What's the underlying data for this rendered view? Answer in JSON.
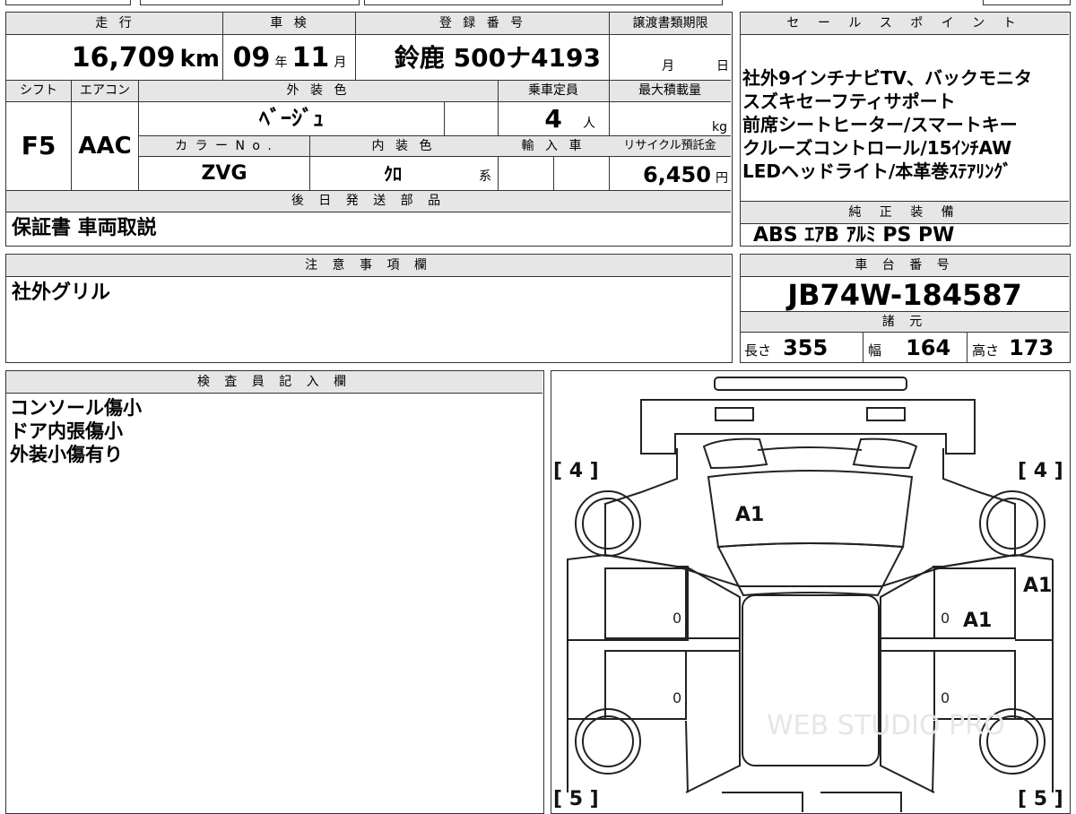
{
  "top": {
    "mileage_label": "走 行",
    "mileage_value": "16,709",
    "mileage_unit": "km",
    "inspection_label": "車 検",
    "inspection_year": "09",
    "inspection_year_unit": "年",
    "inspection_month": "11",
    "inspection_month_unit": "月",
    "registration_label": "登 録 番 号",
    "registration_value": "鈴鹿 500ナ4193",
    "transfer_label": "譲渡書類期限",
    "transfer_month_unit": "月",
    "transfer_day_unit": "日"
  },
  "row2": {
    "shift_label": "シフト",
    "shift_value": "F5",
    "ac_label": "エアコン",
    "ac_value": "AAC",
    "exterior_color_label": "外 装 色",
    "exterior_color_value": "ﾍﾞｰｼﾞｭ",
    "capacity_label": "乗車定員",
    "capacity_value": "4",
    "capacity_unit": "人",
    "max_load_label": "最大積載量",
    "max_load_unit": "kg",
    "color_no_label": "カ ラ ー N o .",
    "color_no_value": "ZVG",
    "interior_color_label": "内 装 色",
    "interior_color_value": "ｸﾛ",
    "interior_color_unit": "系",
    "import_label": "輸 入 車",
    "recycle_label": "リサイクル預託金",
    "recycle_value": "6,450",
    "recycle_unit": "円"
  },
  "later_parts": {
    "label": "後 日 発 送 部 品",
    "value": "保証書 車両取説"
  },
  "sales_points": {
    "label": "セ ー ル ス ポ イ ン ト",
    "lines": [
      "社外9インチナビTV、バックモニタ",
      "スズキセーフティサポート",
      "前席シートヒーター/スマートキー",
      "クルーズコントロール/15ｲﾝﾁAW",
      "LEDヘッドライト/本革巻ｽﾃｱﾘﾝｸﾞ"
    ]
  },
  "genuine_equipment": {
    "label": "純 正 装 備",
    "value": "ABS ｴｱB ｱﾙﾐ PS PW"
  },
  "notes": {
    "label": "注 意 事 項 欄",
    "value": "社外グリル"
  },
  "chassis": {
    "label": "車 台 番 号",
    "value": "JB74W-184587",
    "specs_label": "諸 元",
    "length_label": "長さ",
    "length_value": "355",
    "width_label": "幅",
    "width_value": "164",
    "height_label": "高さ",
    "height_value": "173"
  },
  "inspector": {
    "label": "検 査 員 記 入 欄",
    "lines": [
      "コンソール傷小",
      "ドア内張傷小",
      "外装小傷有り"
    ]
  },
  "diagram": {
    "tire_front_left": "[ 4 ]",
    "tire_front_right": "[ 4 ]",
    "tire_rear_left": "[ 5 ]",
    "tire_rear_right": "[ 5 ]",
    "mark_hood": "A1",
    "mark_right_fender": "A1",
    "mark_right_front_door": "A1",
    "zero_marks": [
      "0",
      "0",
      "0",
      "0"
    ],
    "watermark": "WEB STUDIO PRO"
  }
}
